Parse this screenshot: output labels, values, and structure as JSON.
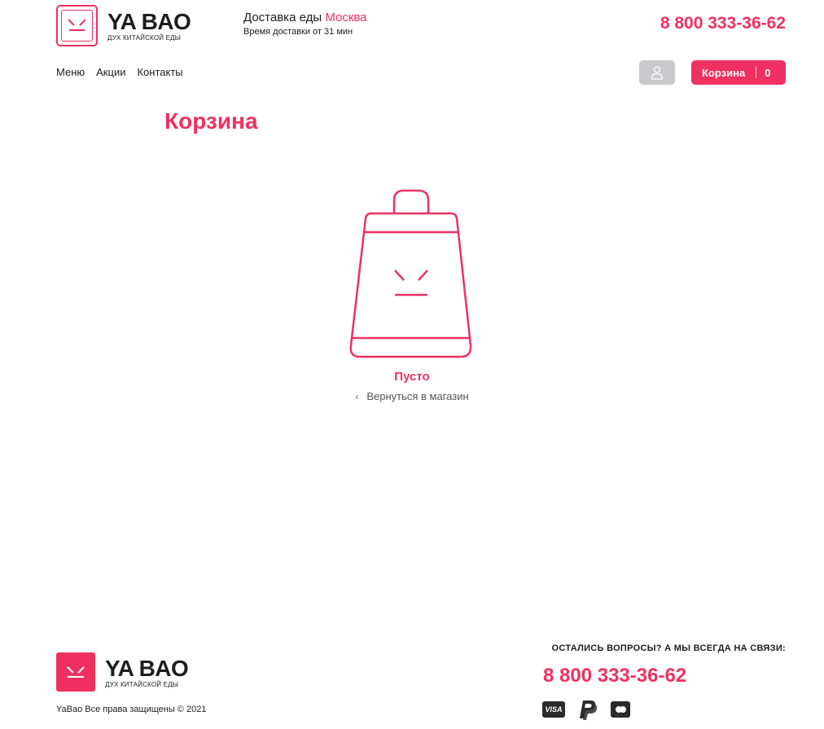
{
  "brand": {
    "name": "YA BAO",
    "tagline": "ДУХ КИТАЙСКОЙ ЕДЫ",
    "accent": "#ee3160"
  },
  "header": {
    "delivery_prefix": "Доставка еды",
    "city": "Москва",
    "delivery_time": "Время доставки от 31 мин",
    "phone": "8 800 333-36-62",
    "nav": [
      {
        "label": "Меню"
      },
      {
        "label": "Акции"
      },
      {
        "label": "Контакты"
      }
    ],
    "user_icon": "user-icon",
    "cart_label": "Корзина",
    "cart_count": "0"
  },
  "main": {
    "title": "Корзина",
    "empty_icon": "shopping-bag-icon",
    "empty_text": "Пусто",
    "back_link": "Вернуться в магазин"
  },
  "footer": {
    "question": "ОСТАЛИСЬ ВОПРОСЫ? А МЫ ВСЕГДА НА СВЯЗИ:",
    "phone": "8 800 333-36-62",
    "copyright": "YaBao Все права защищены © 2021",
    "payments": {
      "visa": "VISA",
      "paypal_icon": "paypal-icon",
      "mastercard_icon": "mastercard-icon"
    }
  }
}
